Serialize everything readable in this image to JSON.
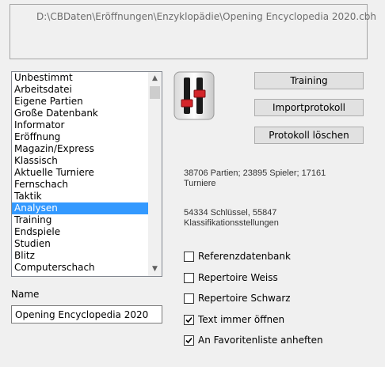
{
  "path": "D:\\CBDaten\\Eröffnungen\\Enzyklopädie\\Opening Encyclopedia 2020.cbh",
  "list": {
    "items": [
      "Unbestimmt",
      "Arbeitsdatei",
      "Eigene Partien",
      "Große Datenbank",
      "Informator",
      "Eröffnung",
      "Magazin/Express",
      "Klassisch",
      "Aktuelle Turniere",
      "Fernschach",
      "Taktik",
      "Analysen",
      "Training",
      "Endspiele",
      "Studien",
      "Blitz",
      "Computerschach"
    ],
    "selected": "Analysen"
  },
  "name_label": "Name",
  "name_value": "Opening Encyclopedia 2020",
  "buttons": {
    "training": "Training",
    "importprotokoll": "Importprotokoll",
    "protokoll_loeschen": "Protokoll löschen"
  },
  "info": {
    "stats_line1": "38706 Partien; 23895 Spieler; 17161",
    "stats_line2": "Turniere",
    "keys_line1": "54334 Schlüssel, 55847",
    "keys_line2": "Klassifikationsstellungen"
  },
  "checkboxes": [
    {
      "label": "Referenzdatenbank",
      "checked": false
    },
    {
      "label": "Repertoire Weiss",
      "checked": false
    },
    {
      "label": "Repertoire Schwarz",
      "checked": false
    },
    {
      "label": "Text immer öffnen",
      "checked": true
    },
    {
      "label": "An Favoritenliste anheften",
      "checked": true
    }
  ],
  "colors": {
    "selection": "#3399ff",
    "icon_red": "#d4252a"
  }
}
